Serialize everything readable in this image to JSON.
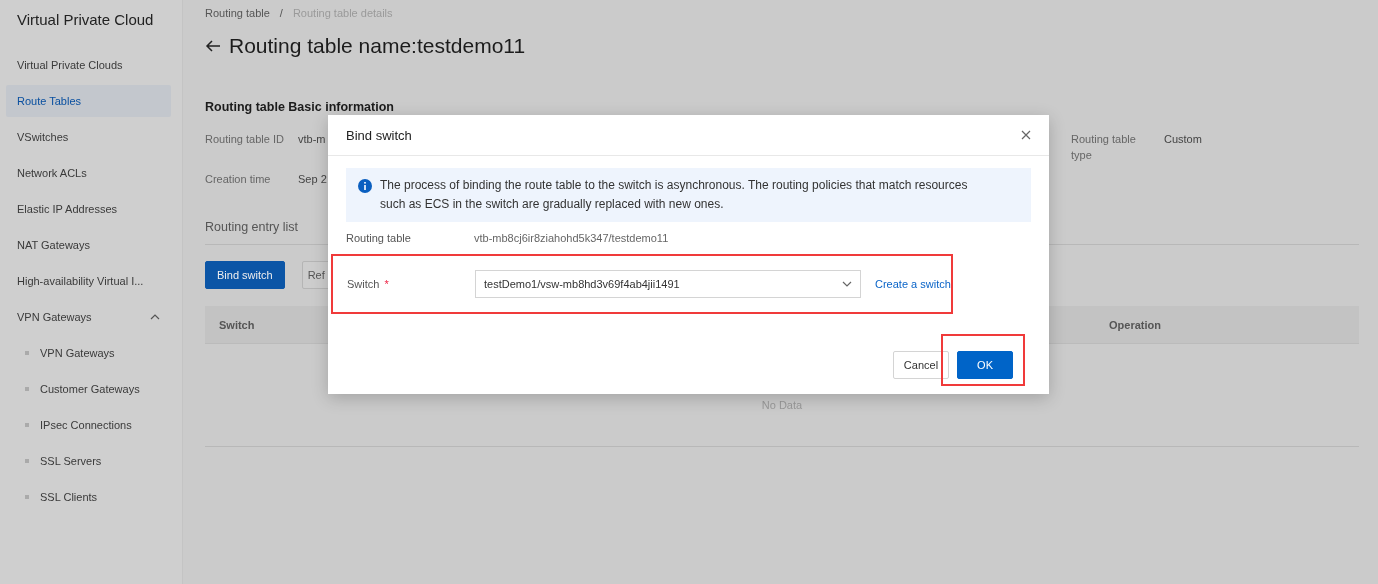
{
  "sidebar": {
    "title": "Virtual Private Cloud",
    "items": [
      {
        "label": "Virtual Private Clouds",
        "selected": false
      },
      {
        "label": "Route Tables",
        "selected": true
      },
      {
        "label": "VSwitches",
        "selected": false
      },
      {
        "label": "Network ACLs",
        "selected": false
      },
      {
        "label": "Elastic IP Addresses",
        "selected": false
      },
      {
        "label": "NAT Gateways",
        "selected": false
      },
      {
        "label": "High-availability Virtual I...",
        "selected": false
      },
      {
        "label": "VPN Gateways",
        "selected": false,
        "expanded": true,
        "children": [
          {
            "label": "VPN Gateways",
            "selected": false
          },
          {
            "label": "Customer Gateways",
            "selected": false
          },
          {
            "label": "IPsec Connections",
            "selected": false
          },
          {
            "label": "SSL Servers",
            "selected": false
          },
          {
            "label": "SSL Clients",
            "selected": false
          }
        ]
      }
    ]
  },
  "breadcrumb": [
    "Routing table",
    "Routing table details"
  ],
  "breadcrumb_separator": "/",
  "page_title": "Routing table name:testdemo11",
  "basic_info": {
    "title": "Routing table Basic information",
    "fields": [
      {
        "label": "Routing table ID",
        "value": "vtb-m"
      },
      {
        "label": "Creation time",
        "value": "Sep 2"
      }
    ],
    "right_fields": [
      {
        "label": "Routing table type",
        "value": "Custom"
      }
    ]
  },
  "entry_list": {
    "title": "Routing entry list",
    "buttons": [
      {
        "label": "Bind switch",
        "kind": "primary"
      },
      {
        "label": "Ref",
        "kind": "default"
      }
    ],
    "columns": [
      "Switch",
      "Operation"
    ],
    "empty_text": "No Data"
  },
  "dialog": {
    "title": "Bind switch",
    "notice": "The process of binding the route table to the switch is asynchronous. The routing policies that match resources such as ECS in the switch are gradually replaced with new ones.",
    "routing_table": {
      "label": "Routing table",
      "value": "vtb-mb8cj6ir8ziahohd5k347/testdemo11"
    },
    "switch": {
      "label": "Switch",
      "required_mark": "*",
      "value": "testDemo1/vsw-mb8hd3v69f4ab4jii1491",
      "highlighted": true
    },
    "create_link": "Create a switch",
    "buttons": [
      {
        "label": "Cancel",
        "kind": "default",
        "highlighted": false
      },
      {
        "label": "OK",
        "kind": "primary",
        "highlighted": true
      }
    ]
  }
}
